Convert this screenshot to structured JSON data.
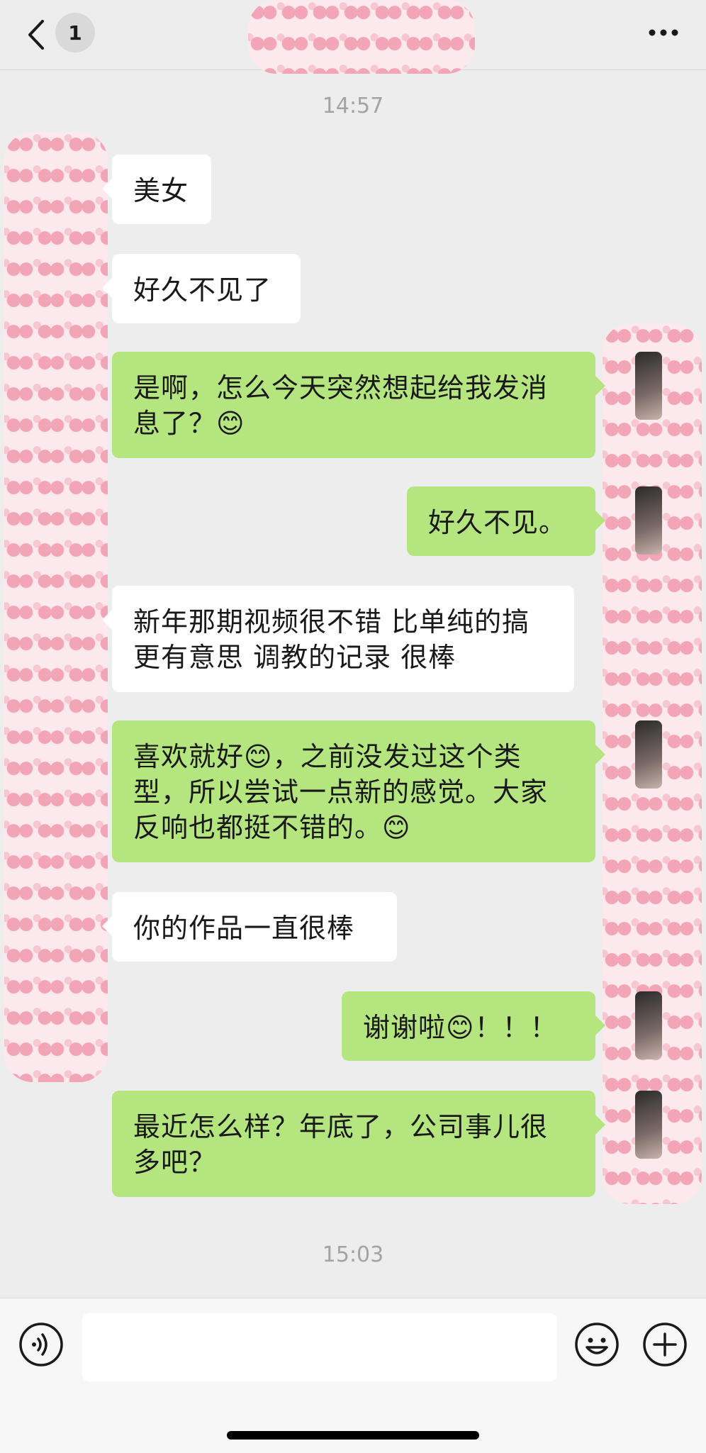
{
  "header": {
    "unread_count": "1",
    "back_icon": "chevron-left-icon",
    "more_icon": "ellipsis-icon"
  },
  "timestamps": [
    "14:57",
    "15:03"
  ],
  "messages": [
    {
      "side": "in",
      "text": "美女"
    },
    {
      "side": "in",
      "text": "好久不见了"
    },
    {
      "side": "out",
      "text": "是啊，怎么今天突然想起给我发消息了？",
      "emoji_end": "😊"
    },
    {
      "side": "out",
      "text": "好久不见。"
    },
    {
      "side": "in",
      "text": "新年那期视频很不错 比单纯的搞更有意思 调教的记录 很棒"
    },
    {
      "side": "out",
      "text_a": "喜欢就好",
      "emoji_a": "😊",
      "text_b": "，之前没发过这个类型，所以尝试一点新的感觉。大家反响也都挺不错的。",
      "emoji_end": "😊"
    },
    {
      "side": "in",
      "text": "你的作品一直很棒"
    },
    {
      "side": "out",
      "text_a": "谢谢啦",
      "emoji_a": "😊",
      "text_b": "！！！"
    },
    {
      "side": "out",
      "text": "最近怎么样？年底了，公司事儿很多吧？"
    }
  ],
  "input_bar": {
    "voice_icon": "voice-icon",
    "input_value": "",
    "emoji_icon": "smiley-icon",
    "plus_icon": "plus-icon"
  },
  "colors": {
    "background": "#ededed",
    "outgoing_bubble": "#b4e57f",
    "incoming_bubble": "#ffffff",
    "timestamp": "#a3a3a3"
  }
}
